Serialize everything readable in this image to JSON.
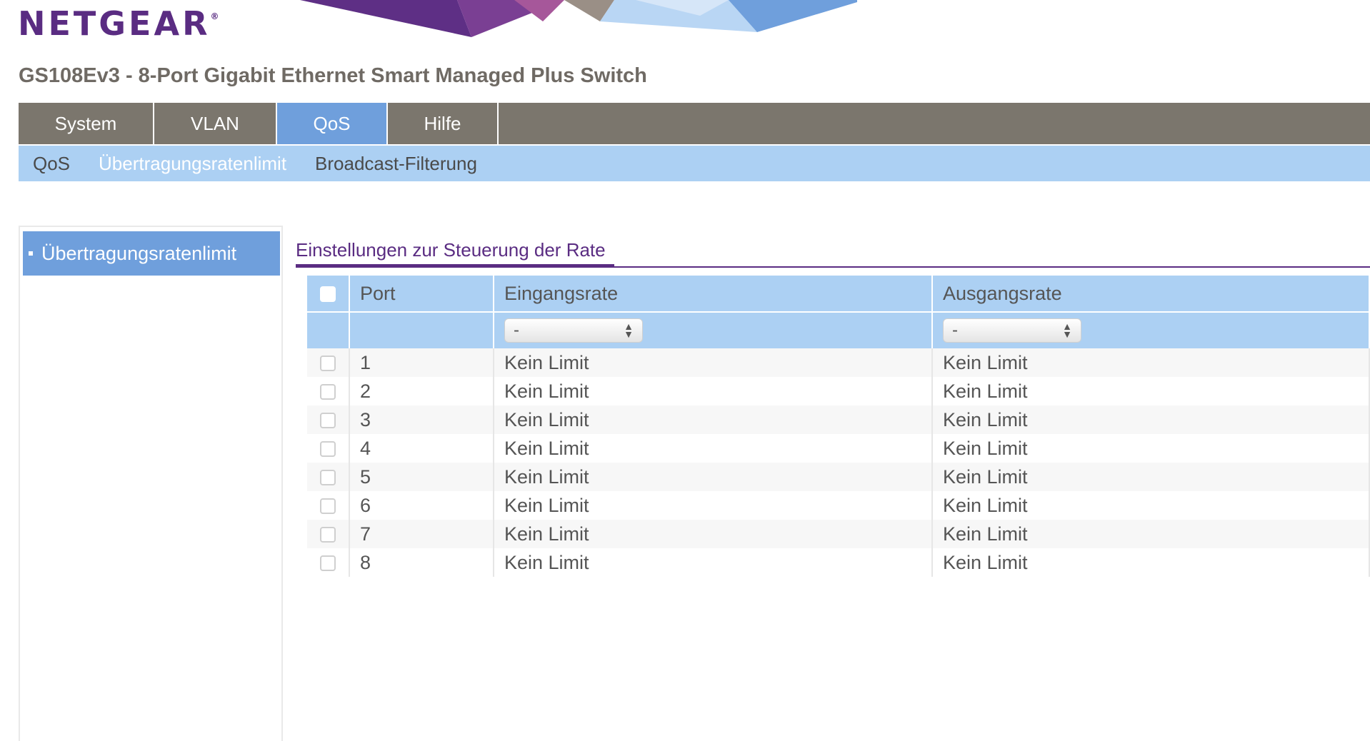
{
  "logo": {
    "text": "NETGEAR",
    "reg": "®"
  },
  "product_title": "GS108Ev3 - 8-Port Gigabit Ethernet Smart Managed Plus Switch",
  "main_nav": [
    {
      "label": "System",
      "active": false
    },
    {
      "label": "VLAN",
      "active": false
    },
    {
      "label": "QoS",
      "active": true
    },
    {
      "label": "Hilfe",
      "active": false
    }
  ],
  "sub_nav": [
    {
      "label": "QoS",
      "active": false
    },
    {
      "label": "Übertragungsratenlimit",
      "active": true
    },
    {
      "label": "Broadcast-Filterung",
      "active": false
    }
  ],
  "left_menu": [
    {
      "label": "Übertragungsratenlimit",
      "active": true
    }
  ],
  "section_title": "Einstellungen zur Steuerung der Rate",
  "table": {
    "headers": {
      "port": "Port",
      "ingress": "Eingangsrate",
      "egress": "Ausgangsrate"
    },
    "filter": {
      "ingress": "-",
      "egress": "-"
    },
    "rows": [
      {
        "port": "1",
        "ingress": "Kein Limit",
        "egress": "Kein Limit"
      },
      {
        "port": "2",
        "ingress": "Kein Limit",
        "egress": "Kein Limit"
      },
      {
        "port": "3",
        "ingress": "Kein Limit",
        "egress": "Kein Limit"
      },
      {
        "port": "4",
        "ingress": "Kein Limit",
        "egress": "Kein Limit"
      },
      {
        "port": "5",
        "ingress": "Kein Limit",
        "egress": "Kein Limit"
      },
      {
        "port": "6",
        "ingress": "Kein Limit",
        "egress": "Kein Limit"
      },
      {
        "port": "7",
        "ingress": "Kein Limit",
        "egress": "Kein Limit"
      },
      {
        "port": "8",
        "ingress": "Kein Limit",
        "egress": "Kein Limit"
      }
    ]
  },
  "colors": {
    "brand_purple": "#5a2c82",
    "nav_gray": "#7b766d",
    "active_blue": "#6f9fdc",
    "light_blue": "#acd0f3"
  }
}
